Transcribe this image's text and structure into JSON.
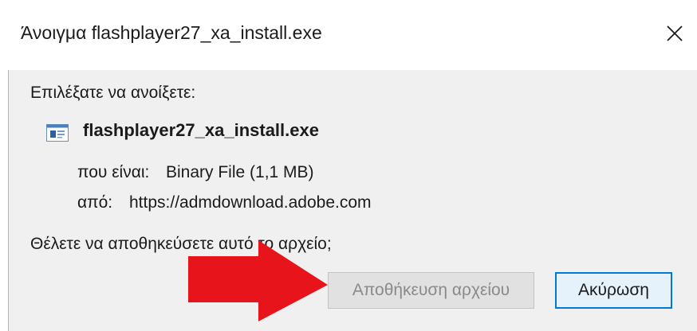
{
  "window": {
    "title": "Άνοιγμα flashplayer27_xa_install.exe",
    "close_icon": "close-icon"
  },
  "dialog": {
    "prompt": "Επιλέξατε να ανοίξετε:",
    "file_icon": "exe-file-icon",
    "filename": "flashplayer27_xa_install.exe",
    "type_label": "που είναι:",
    "type_value": "Binary File (1,1 MB)",
    "from_label": "από:",
    "from_value": "https://admdownload.adobe.com",
    "question": "Θέλετε να αποθηκεύσετε αυτό το αρχείο;",
    "save_button": "Αποθήκευση αρχείου",
    "cancel_button": "Ακύρωση"
  },
  "annotation": {
    "arrow_icon": "red-arrow-pointer-icon",
    "arrow_color": "#e8141c"
  },
  "colors": {
    "accent": "#0078d7",
    "content_bg": "#f0f0f0",
    "disabled_text": "#8a8a8a"
  }
}
